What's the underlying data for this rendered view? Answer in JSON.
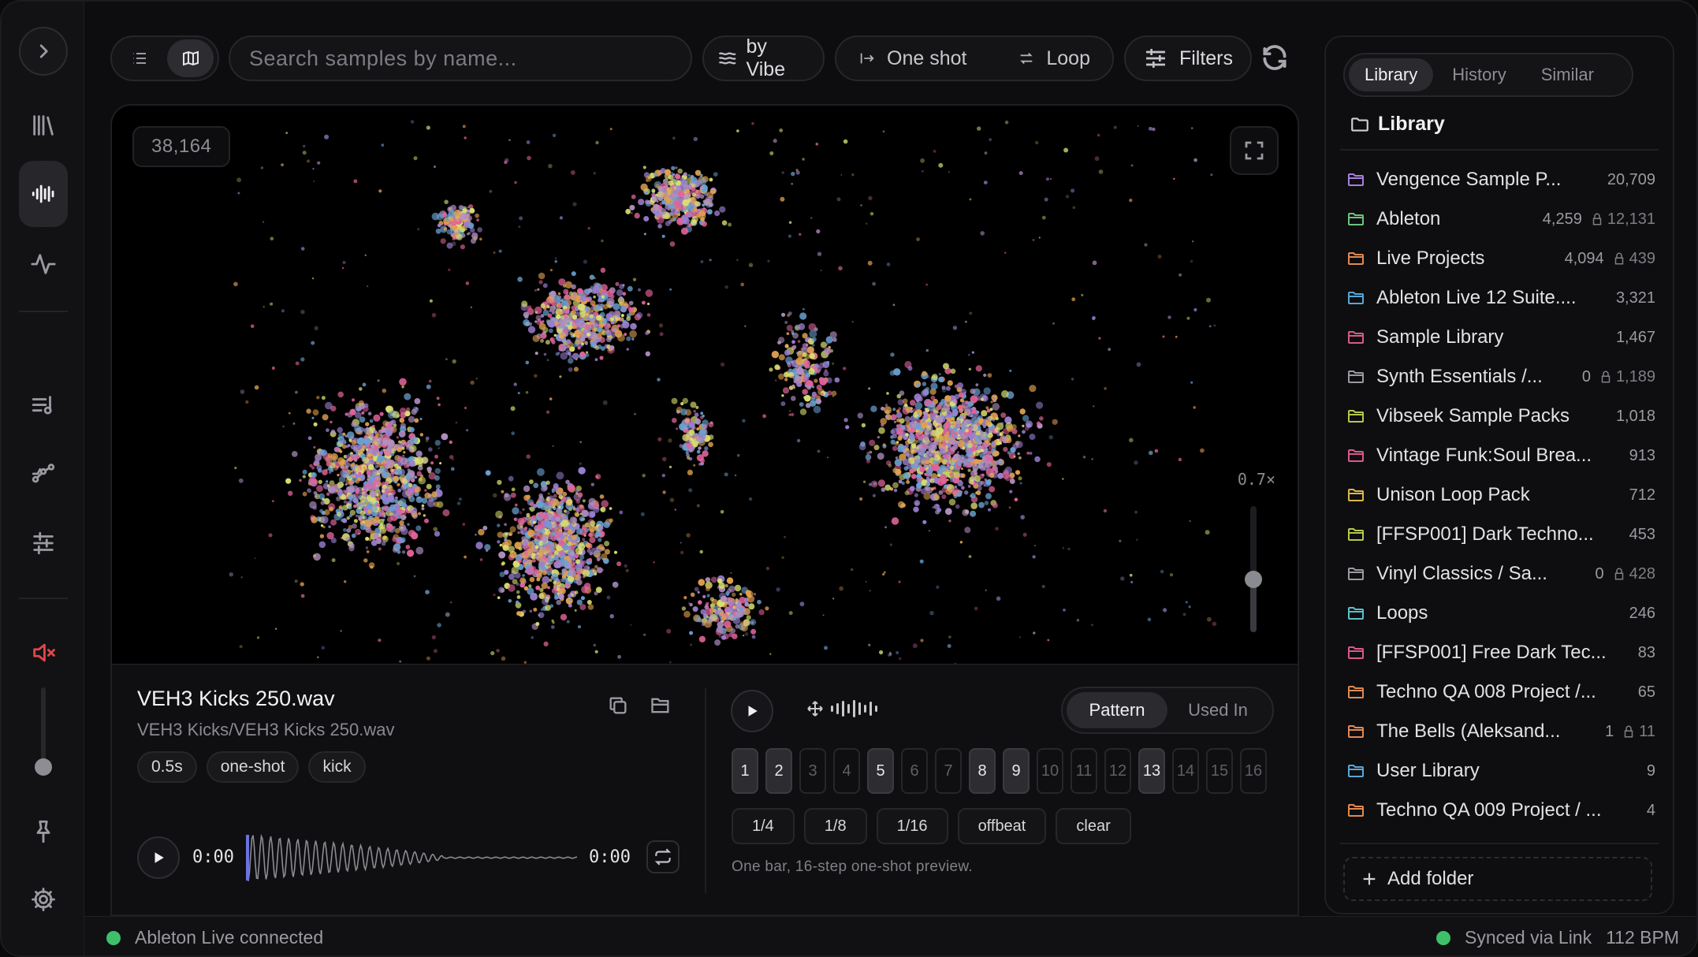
{
  "toolbar": {
    "search_placeholder": "Search samples by name...",
    "vibe_label": "by Vibe",
    "one_shot_label": "One shot",
    "loop_label": "Loop",
    "filters_label": "Filters"
  },
  "map": {
    "sample_count": "38,164",
    "zoom_label": "0.7×",
    "zoom_level": 0.7
  },
  "player": {
    "file_title": "VEH3 Kicks 250.wav",
    "file_path": "VEH3 Kicks/VEH3 Kicks 250.wav",
    "tags": [
      "0.5s",
      "one-shot",
      "kick"
    ],
    "time_current": "0:00",
    "time_total": "0:00"
  },
  "sequencer": {
    "tabs": [
      "Pattern",
      "Used In"
    ],
    "active_tab": "Pattern",
    "steps": [
      "1",
      "2",
      "3",
      "4",
      "5",
      "6",
      "7",
      "8",
      "9",
      "10",
      "11",
      "12",
      "13",
      "14",
      "15",
      "16"
    ],
    "active_steps": [
      1,
      2,
      5,
      8,
      9,
      13
    ],
    "presets": [
      "1/4",
      "1/8",
      "1/16",
      "offbeat",
      "clear"
    ],
    "hint": "One bar, 16-step one-shot preview."
  },
  "sidebar": {
    "tabs": [
      "Library",
      "History",
      "Similar"
    ],
    "active_tab": "Library",
    "heading": "Library",
    "folders": [
      {
        "name": "Vengence Sample P...",
        "count": "20,709",
        "locked": "",
        "color": "#a77fe0"
      },
      {
        "name": "Ableton",
        "count": "4,259",
        "locked": "12,131",
        "color": "#6ec27a"
      },
      {
        "name": "Live Projects",
        "count": "4,094",
        "locked": "439",
        "color": "#e08a52"
      },
      {
        "name": "Ableton Live 12 Suite....",
        "count": "3,321",
        "locked": "",
        "color": "#5aa6d8"
      },
      {
        "name": "Sample Library",
        "count": "1,467",
        "locked": "",
        "color": "#d85a8a"
      },
      {
        "name": "Synth Essentials /...",
        "count": "0",
        "locked": "1,189",
        "color": "#9a9aa1"
      },
      {
        "name": "Vibseek Sample Packs",
        "count": "1,018",
        "locked": "",
        "color": "#b4c94e"
      },
      {
        "name": "Vintage Funk:Soul Brea...",
        "count": "913",
        "locked": "",
        "color": "#d85a8a"
      },
      {
        "name": "Unison Loop Pack",
        "count": "712",
        "locked": "",
        "color": "#d9b84a"
      },
      {
        "name": "[FFSP001] Dark Techno...",
        "count": "453",
        "locked": "",
        "color": "#b4c94e"
      },
      {
        "name": "Vinyl Classics / Sa...",
        "count": "0",
        "locked": "428",
        "color": "#9a9aa1"
      },
      {
        "name": "Loops",
        "count": "246",
        "locked": "",
        "color": "#5ac0c8"
      },
      {
        "name": "[FFSP001] Free Dark Tec...",
        "count": "83",
        "locked": "",
        "color": "#d85a8a"
      },
      {
        "name": "Techno QA 008 Project /...",
        "count": "65",
        "locked": "",
        "color": "#e08a52"
      },
      {
        "name": "The Bells (Aleksand...",
        "count": "1",
        "locked": "11",
        "color": "#e08a52"
      },
      {
        "name": "User Library",
        "count": "9",
        "locked": "",
        "color": "#5aa6d8"
      },
      {
        "name": "Techno QA 009 Project / ...",
        "count": "4",
        "locked": "",
        "color": "#e08a52"
      }
    ],
    "add_folder_label": "Add folder"
  },
  "status": {
    "left": "Ableton Live connected",
    "sync": "Synced via Link",
    "bpm": "112 BPM"
  },
  "colors": {
    "accent_green": "#3fbf6a",
    "mute_red": "#e0474a",
    "cluster_palette": [
      "#e0649a",
      "#9a7fd0",
      "#e0a050",
      "#d9e070",
      "#b08fc0",
      "#6aa0d0"
    ]
  }
}
